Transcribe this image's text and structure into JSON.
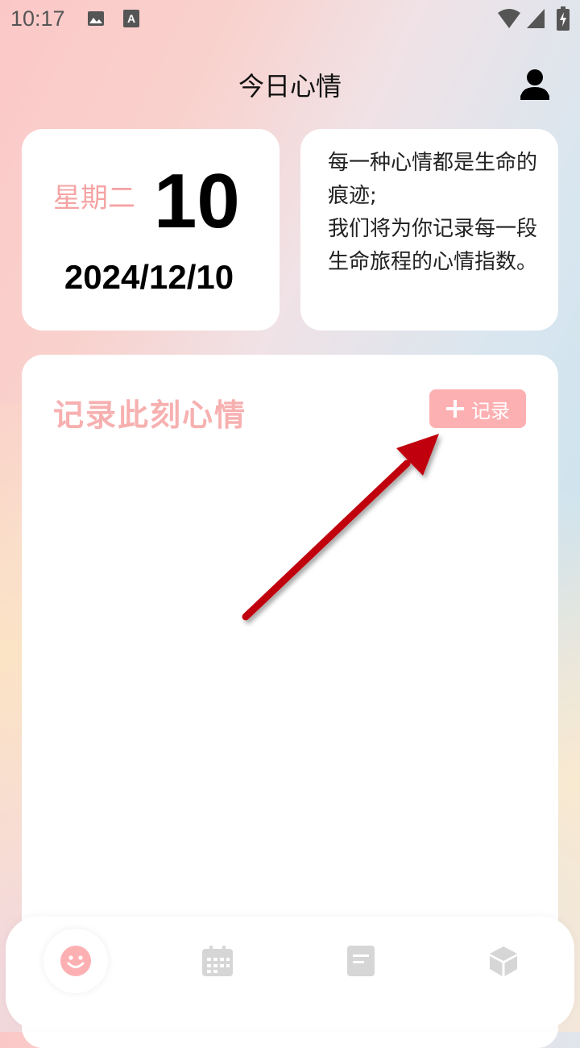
{
  "status_bar": {
    "time": "10:17",
    "icons": [
      "image-icon",
      "text-a-icon",
      "wifi-icon",
      "signal-icon",
      "battery-charging-icon"
    ]
  },
  "header": {
    "title": "今日心情",
    "user_icon": "user-icon"
  },
  "date_card": {
    "weekday": "星期二",
    "day": "10",
    "full_date": "2024/12/10"
  },
  "quote_card": {
    "text": "每一种心情都是生命的痕迹;\n我们将为你记录每一段生命旅程的心情指数。"
  },
  "record_section": {
    "title": "记录此刻心情",
    "button_label": "记录",
    "button_icon": "plus-icon"
  },
  "bottom_nav": {
    "items": [
      {
        "icon": "smiley-icon",
        "active": true
      },
      {
        "icon": "calendar-icon",
        "active": false
      },
      {
        "icon": "note-icon",
        "active": false
      },
      {
        "icon": "cube-icon",
        "active": false
      }
    ]
  },
  "colors": {
    "accent_pink": "#f6a3a3",
    "button_pink": "#fdb0b2",
    "arrow_red": "#c0000c",
    "nav_inactive": "#d6d6d6"
  }
}
